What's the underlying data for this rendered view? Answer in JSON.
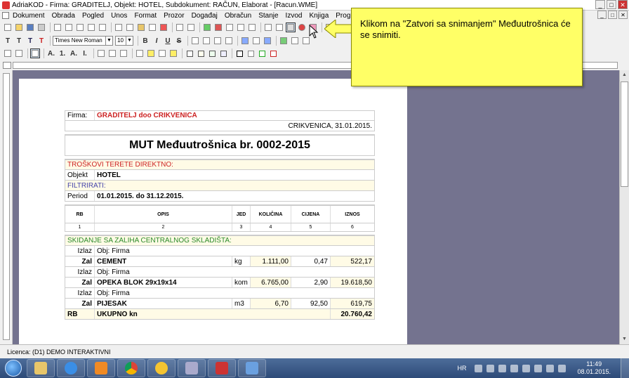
{
  "window": {
    "title": "AdriaKOD - Firma: GRADITELJ,  Objekt: HOTEL,  Subdokument: RAČUN,  Elaborat - [Racun.WME]",
    "controls": [
      "_",
      "□",
      "✕"
    ]
  },
  "menu": {
    "items": [
      "Dokument",
      "Obrada",
      "Pogled",
      "Unos",
      "Format",
      "Prozor",
      "Događaj",
      "Obračun",
      "Stanje",
      "Izvod",
      "Knjiga",
      "Program"
    ]
  },
  "toolbar": {
    "font_name": "Times New Roman",
    "font_size": "10",
    "text_buttons": [
      "T",
      "T",
      "T",
      "T"
    ],
    "format_buttons": [
      "B",
      "I",
      "U",
      "S"
    ],
    "list_buttons": [
      "A.",
      "1.",
      "A.",
      "I."
    ]
  },
  "callout": {
    "text": "Klikom na \"Zatvori sa snimanjem\" Međuutrošnica će se snimiti."
  },
  "document": {
    "firma_label": "Firma:",
    "firma_value": "GRADITELJ doo CRIKVENICA",
    "date_line": "CRIKVENICA, 31.01.2015.",
    "title": "MUT Međuutrošnica br. 0002-2015",
    "troskovi_label": "TROŠKOVI TERETE DIREKTNO:",
    "objekt_label": "Objekt",
    "objekt_value": "HOTEL",
    "filtrirati_label": "FILTRIRATI:",
    "period_label": "Period",
    "period_value": "01.01.2015. do 31.12.2015.",
    "columns": [
      "RB",
      "OPIS",
      "JED",
      "KOLIČINA",
      "CIJENA",
      "IZNOS"
    ],
    "column_numbers": [
      "1",
      "2",
      "3",
      "4",
      "5",
      "6"
    ],
    "section_title": "SKIDANJE SA ZALIHA CENTRALNOG SKLADIŠTA:",
    "items": [
      {
        "izlaz": "Izlaz",
        "obj": "Obj: Firma",
        "rb": "Zal",
        "opis": "CEMENT",
        "jed": "kg",
        "kolicina": "1.111,00",
        "cijena": "0,47",
        "iznos": "522,17"
      },
      {
        "izlaz": "Izlaz",
        "obj": "Obj: Firma",
        "rb": "Zal",
        "opis": "OPEKA BLOK 29x19x14",
        "jed": "kom",
        "kolicina": "6.765,00",
        "cijena": "2,90",
        "iznos": "19.618,50"
      },
      {
        "izlaz": "Izlaz",
        "obj": "Obj: Firma",
        "rb": "Zal",
        "opis": "PIJESAK",
        "jed": "m3",
        "kolicina": "6,70",
        "cijena": "92,50",
        "iznos": "619,75"
      }
    ],
    "total_rb": "RB",
    "total_label": "UKUPNO kn",
    "total_value": "20.760,42"
  },
  "statusbar": {
    "text": "Licenca: (D1) DEMO INTERAKTIVNI"
  },
  "taskbar": {
    "lang": "HR",
    "time": "11:49",
    "date": "08.01.2015."
  }
}
